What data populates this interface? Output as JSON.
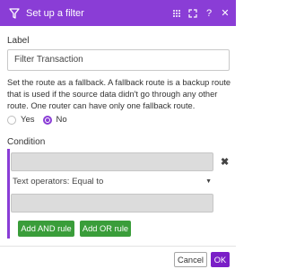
{
  "dialog": {
    "title": "Set up a filter",
    "header_icons": [
      "filter-icon",
      "grip-icon",
      "expand-icon",
      "help-icon",
      "close-icon"
    ],
    "help_glyph": "?",
    "close_glyph": "✕"
  },
  "label": {
    "title": "Label",
    "value": "Filter Transaction"
  },
  "fallback": {
    "description": "Set the route as a fallback. A fallback route is a backup route that is used if the source data didn't go through any other route. One router can have only one fallback route.",
    "options": [
      {
        "label": "Yes",
        "selected": false
      },
      {
        "label": "No",
        "selected": true
      }
    ]
  },
  "condition": {
    "title": "Condition",
    "operator": "Text operators: Equal to",
    "add_and_label": "Add AND rule",
    "add_or_label": "Add OR rule",
    "remove_glyph": "✖"
  },
  "footer": {
    "cancel_label": "Cancel",
    "ok_label": "OK"
  },
  "colors": {
    "accent": "#8a3dd6",
    "ok_button": "#7a1fc7",
    "green_button": "#3a9d3a"
  }
}
